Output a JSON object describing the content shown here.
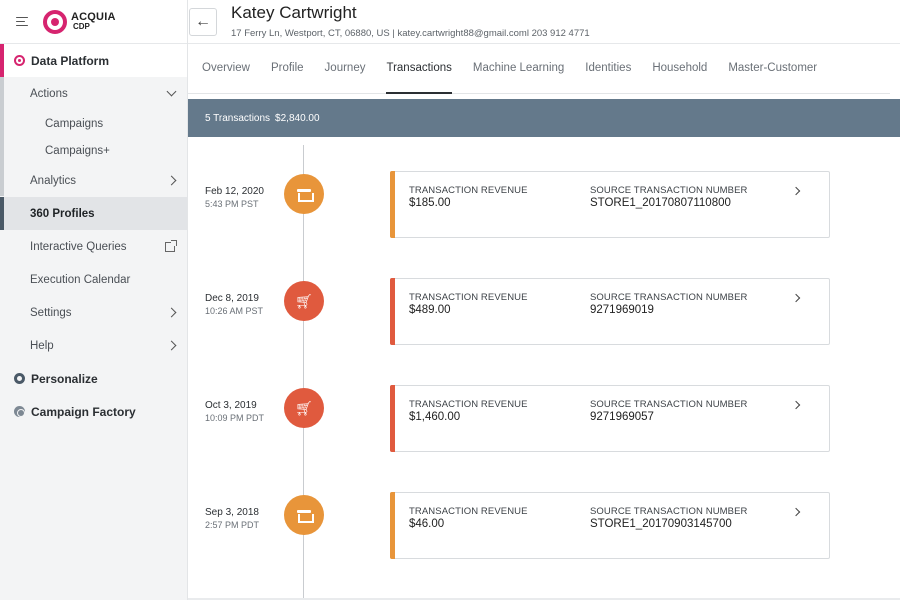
{
  "brand": {
    "line1": "ACQUIA",
    "line2": "CDP"
  },
  "sidebar": {
    "data_platform": "Data Platform",
    "actions": "Actions",
    "campaigns": "Campaigns",
    "campaigns_plus": "Campaigns+",
    "analytics": "Analytics",
    "profiles": "360 Profiles",
    "interactive_queries": "Interactive Queries",
    "execution_calendar": "Execution Calendar",
    "settings": "Settings",
    "help": "Help",
    "personalize": "Personalize",
    "campaign_factory": "Campaign Factory"
  },
  "customer": {
    "name": "Katey Cartwright",
    "info": "17 Ferry Ln, Westport, CT, 06880, US | katey.cartwright88@gmail.coml 203 912 4771"
  },
  "tabs": [
    "Overview",
    "Profile",
    "Journey",
    "Transactions",
    "Machine Learning",
    "Identities",
    "Household",
    "Master-Customer"
  ],
  "active_tab": "Transactions",
  "summary": {
    "count": "5 Transactions",
    "total": "$2,840.00"
  },
  "labels": {
    "revenue": "TRANSACTION REVENUE",
    "source": "SOURCE TRANSACTION NUMBER"
  },
  "colors": {
    "store": "#e8953a",
    "online": "#e05a3e",
    "brand": "#d6246f",
    "summary_bar": "#64798b"
  },
  "transactions": [
    {
      "date": "Feb 12, 2020",
      "time": "5:43 PM PST",
      "channel": "store",
      "icon": "store-icon",
      "revenue": "$185.00",
      "source": "STORE1_20170807110800"
    },
    {
      "date": "Dec 8, 2019",
      "time": "10:26 AM PST",
      "channel": "online",
      "icon": "cart-icon",
      "revenue": "$489.00",
      "source": "9271969019"
    },
    {
      "date": "Oct 3, 2019",
      "time": "10:09 PM PDT",
      "channel": "online",
      "icon": "cart-icon",
      "revenue": "$1,460.00",
      "source": "9271969057"
    },
    {
      "date": "Sep 3, 2018",
      "time": "2:57 PM PDT",
      "channel": "store",
      "icon": "store-icon",
      "revenue": "$46.00",
      "source": "STORE1_20170903145700"
    }
  ]
}
